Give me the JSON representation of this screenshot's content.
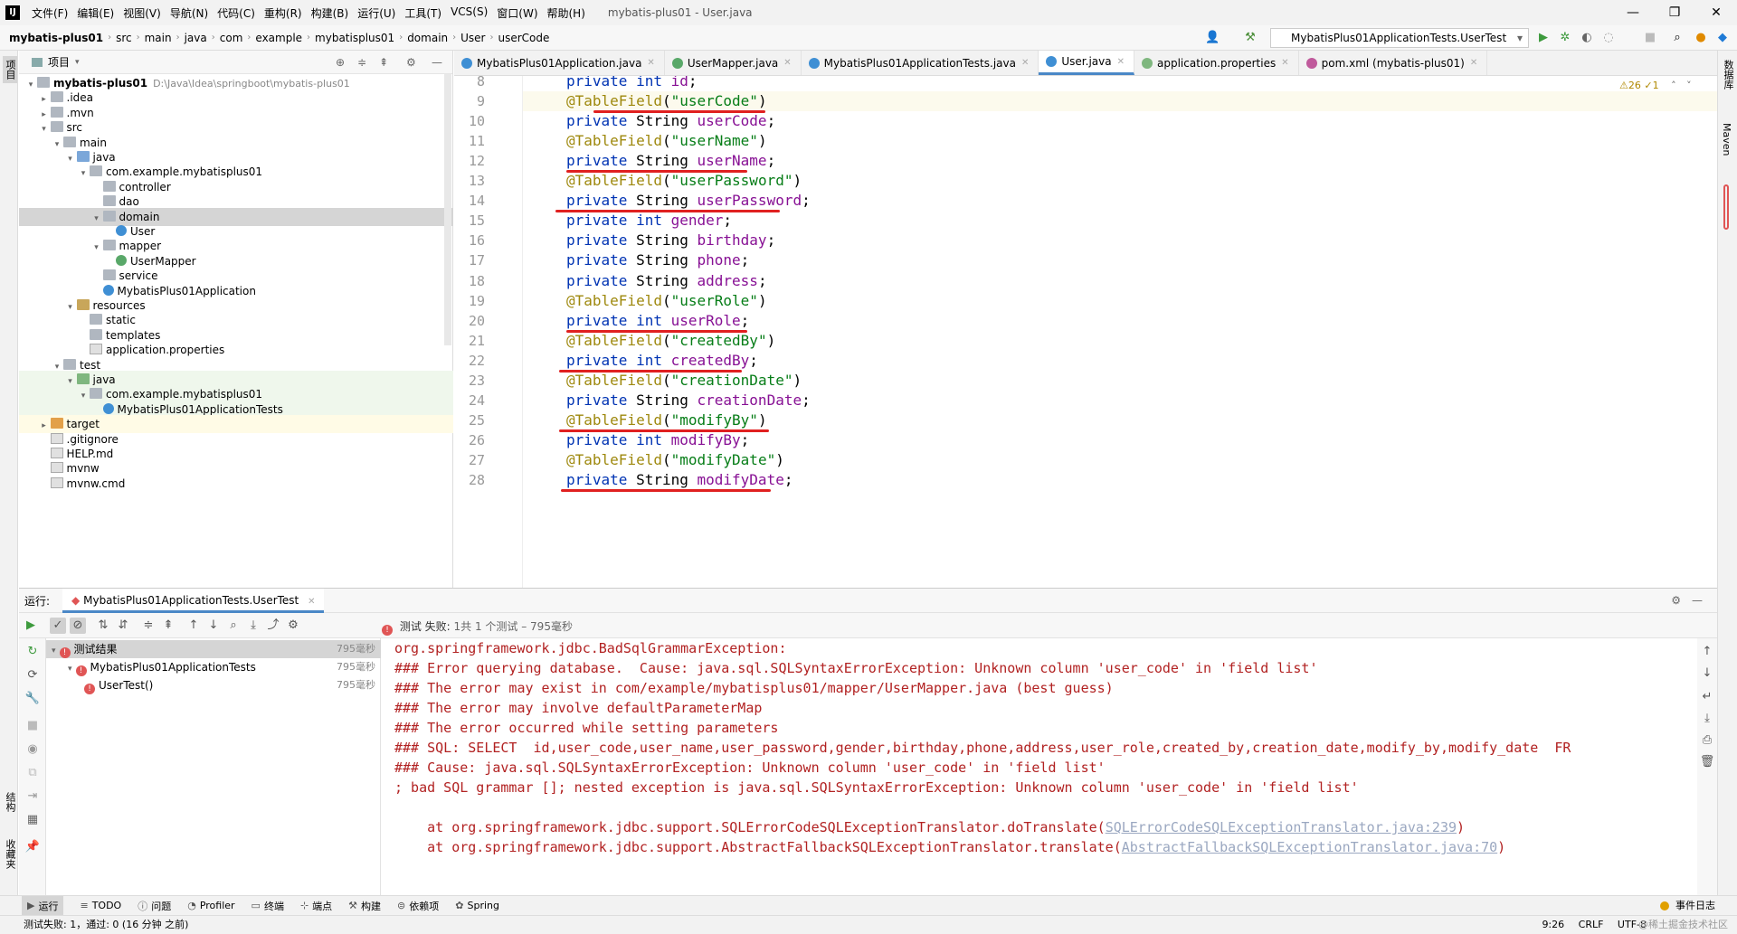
{
  "menubar": {
    "items": [
      "文件(F)",
      "编辑(E)",
      "视图(V)",
      "导航(N)",
      "代码(C)",
      "重构(R)",
      "构建(B)",
      "运行(U)",
      "工具(T)",
      "VCS(S)",
      "窗口(W)",
      "帮助(H)"
    ],
    "window_title": "mybatis-plus01 - User.java"
  },
  "navbar": {
    "crumbs": [
      "mybatis-plus01",
      "src",
      "main",
      "java",
      "com",
      "example",
      "mybatisplus01",
      "domain",
      "User",
      "userCode"
    ],
    "run_config": "MybatisPlus01ApplicationTests.UserTest"
  },
  "left_strip": {
    "project_label": "项目",
    "structure_label": "结构",
    "bookmarks_label": "收藏夹"
  },
  "right_strip": {
    "db_label": "数据库",
    "maven_label": "Maven"
  },
  "project": {
    "header": "项目",
    "tree": [
      {
        "label": "mybatis-plus01",
        "path": "D:\\Java\\Idea\\springboot\\mybatis-plus01",
        "icon": "folder",
        "depth": 0,
        "arrow": "▾"
      },
      {
        "label": ".idea",
        "icon": "folder",
        "depth": 1,
        "arrow": "▸"
      },
      {
        "label": ".mvn",
        "icon": "folder",
        "depth": 1,
        "arrow": "▸"
      },
      {
        "label": "src",
        "icon": "folder",
        "depth": 1,
        "arrow": "▾"
      },
      {
        "label": "main",
        "icon": "folder",
        "depth": 2,
        "arrow": "▾"
      },
      {
        "label": "java",
        "icon": "folder-src",
        "depth": 3,
        "arrow": "▾"
      },
      {
        "label": "com.example.mybatisplus01",
        "icon": "folder",
        "depth": 4,
        "arrow": "▾"
      },
      {
        "label": "controller",
        "icon": "folder",
        "depth": 5,
        "arrow": ""
      },
      {
        "label": "dao",
        "icon": "folder",
        "depth": 5,
        "arrow": ""
      },
      {
        "label": "domain",
        "icon": "folder",
        "depth": 5,
        "arrow": "▾"
      },
      {
        "label": "User",
        "icon": "class",
        "depth": 6,
        "arrow": ""
      },
      {
        "label": "mapper",
        "icon": "folder",
        "depth": 5,
        "arrow": "▾"
      },
      {
        "label": "UserMapper",
        "icon": "interface",
        "depth": 6,
        "arrow": ""
      },
      {
        "label": "service",
        "icon": "folder",
        "depth": 5,
        "arrow": ""
      },
      {
        "label": "MybatisPlus01Application",
        "icon": "class",
        "depth": 5,
        "arrow": ""
      },
      {
        "label": "resources",
        "icon": "folder-res",
        "depth": 3,
        "arrow": "▾"
      },
      {
        "label": "static",
        "icon": "folder",
        "depth": 4,
        "arrow": ""
      },
      {
        "label": "templates",
        "icon": "folder",
        "depth": 4,
        "arrow": ""
      },
      {
        "label": "application.properties",
        "icon": "file",
        "depth": 4,
        "arrow": ""
      },
      {
        "label": "test",
        "icon": "folder",
        "depth": 2,
        "arrow": "▾"
      },
      {
        "label": "java",
        "icon": "folder-test",
        "depth": 3,
        "arrow": "▾"
      },
      {
        "label": "com.example.mybatisplus01",
        "icon": "folder",
        "depth": 4,
        "arrow": "▾"
      },
      {
        "label": "MybatisPlus01ApplicationTests",
        "icon": "class",
        "depth": 5,
        "arrow": ""
      },
      {
        "label": "target",
        "icon": "folder-target",
        "depth": 1,
        "arrow": "▸"
      },
      {
        "label": ".gitignore",
        "icon": "file",
        "depth": 1,
        "arrow": ""
      },
      {
        "label": "HELP.md",
        "icon": "file",
        "depth": 1,
        "arrow": ""
      },
      {
        "label": "mvnw",
        "icon": "file",
        "depth": 1,
        "arrow": ""
      },
      {
        "label": "mvnw.cmd",
        "icon": "file",
        "depth": 1,
        "arrow": ""
      }
    ]
  },
  "editor": {
    "tabs": [
      {
        "label": "MybatisPlus01Application.java",
        "color": "#3f8fd4",
        "active": false
      },
      {
        "label": "UserMapper.java",
        "color": "#59a869",
        "active": false
      },
      {
        "label": "MybatisPlus01ApplicationTests.java",
        "color": "#3f8fd4",
        "active": false
      },
      {
        "label": "User.java",
        "color": "#3f8fd4",
        "active": true
      },
      {
        "label": "application.properties",
        "color": "#7fb77f",
        "active": false
      },
      {
        "label": "pom.xml (mybatis-plus01)",
        "color": "#c05a9c",
        "active": false
      }
    ],
    "warnings": "⚠26  ✓1",
    "lines": [
      {
        "n": "8",
        "parts": [
          [
            "kw",
            "private "
          ],
          [
            "kw",
            "int "
          ],
          [
            "fld",
            "id"
          ],
          [
            "",
            "; "
          ]
        ]
      },
      {
        "n": "9",
        "parts": [
          [
            "ann",
            "@TableField"
          ],
          [
            "",
            "("
          ],
          [
            "str",
            "\"userCode\""
          ],
          [
            "",
            ")"
          ]
        ],
        "current": true
      },
      {
        "n": "10",
        "parts": [
          [
            "kw",
            "private "
          ],
          [
            "",
            "String "
          ],
          [
            "fld",
            "userCode"
          ],
          [
            "",
            ";"
          ]
        ]
      },
      {
        "n": "11",
        "parts": [
          [
            "ann",
            "@TableField"
          ],
          [
            "",
            "("
          ],
          [
            "str",
            "\"userName\""
          ],
          [
            "",
            ")"
          ]
        ]
      },
      {
        "n": "12",
        "parts": [
          [
            "kw",
            "private "
          ],
          [
            "",
            "String "
          ],
          [
            "fld",
            "userName"
          ],
          [
            "",
            ";"
          ]
        ]
      },
      {
        "n": "13",
        "parts": [
          [
            "ann",
            "@TableField"
          ],
          [
            "",
            "("
          ],
          [
            "str",
            "\"userPassword\""
          ],
          [
            "",
            ")"
          ]
        ]
      },
      {
        "n": "14",
        "parts": [
          [
            "kw",
            "private "
          ],
          [
            "",
            "String "
          ],
          [
            "fld",
            "userPassword"
          ],
          [
            "",
            ";"
          ]
        ]
      },
      {
        "n": "15",
        "parts": [
          [
            "kw",
            "private "
          ],
          [
            "kw",
            "int "
          ],
          [
            "fld",
            "gender"
          ],
          [
            "",
            ";"
          ]
        ]
      },
      {
        "n": "16",
        "parts": [
          [
            "kw",
            "private "
          ],
          [
            "",
            "String "
          ],
          [
            "fld",
            "birthday"
          ],
          [
            "",
            ";"
          ]
        ]
      },
      {
        "n": "17",
        "parts": [
          [
            "kw",
            "private "
          ],
          [
            "",
            "String "
          ],
          [
            "fld",
            "phone"
          ],
          [
            "",
            ";"
          ]
        ]
      },
      {
        "n": "18",
        "parts": [
          [
            "kw",
            "private "
          ],
          [
            "",
            "String "
          ],
          [
            "fld",
            "address"
          ],
          [
            "",
            ";"
          ]
        ]
      },
      {
        "n": "19",
        "parts": [
          [
            "ann",
            "@TableField"
          ],
          [
            "",
            "("
          ],
          [
            "str",
            "\"userRole\""
          ],
          [
            "",
            ")"
          ]
        ]
      },
      {
        "n": "20",
        "parts": [
          [
            "kw",
            "private "
          ],
          [
            "kw",
            "int "
          ],
          [
            "fld",
            "userRole"
          ],
          [
            "",
            ";"
          ]
        ]
      },
      {
        "n": "21",
        "parts": [
          [
            "ann",
            "@TableField"
          ],
          [
            "",
            "("
          ],
          [
            "str",
            "\"createdBy\""
          ],
          [
            "",
            ")"
          ]
        ]
      },
      {
        "n": "22",
        "parts": [
          [
            "kw",
            "private "
          ],
          [
            "kw",
            "int "
          ],
          [
            "fld",
            "createdBy"
          ],
          [
            "",
            ";"
          ]
        ]
      },
      {
        "n": "23",
        "parts": [
          [
            "ann",
            "@TableField"
          ],
          [
            "",
            "("
          ],
          [
            "str",
            "\"creationDate\""
          ],
          [
            "",
            ")"
          ]
        ]
      },
      {
        "n": "24",
        "parts": [
          [
            "kw",
            "private "
          ],
          [
            "",
            "String "
          ],
          [
            "fld",
            "creationDate"
          ],
          [
            "",
            ";"
          ]
        ]
      },
      {
        "n": "25",
        "parts": [
          [
            "ann",
            "@TableField"
          ],
          [
            "",
            "("
          ],
          [
            "str",
            "\"modifyBy\""
          ],
          [
            "",
            ")"
          ]
        ]
      },
      {
        "n": "26",
        "parts": [
          [
            "kw",
            "private "
          ],
          [
            "kw",
            "int "
          ],
          [
            "fld",
            "modifyBy"
          ],
          [
            "",
            ";"
          ]
        ]
      },
      {
        "n": "27",
        "parts": [
          [
            "ann",
            "@TableField"
          ],
          [
            "",
            "("
          ],
          [
            "str",
            "\"modifyDate\""
          ],
          [
            "",
            ")"
          ]
        ]
      },
      {
        "n": "28",
        "parts": [
          [
            "kw",
            "private "
          ],
          [
            "",
            "String "
          ],
          [
            "fld",
            "modifyDate"
          ],
          [
            "",
            ";"
          ]
        ]
      }
    ]
  },
  "run": {
    "label": "运行:",
    "tab": "MybatisPlus01ApplicationTests.UserTest",
    "status_prefix": "测试 失败:",
    "status_detail": "1共 1 个测试 – 795毫秒",
    "tree": [
      {
        "label": "测试结果",
        "time": "795毫秒",
        "depth": 0
      },
      {
        "label": "MybatisPlus01ApplicationTests",
        "time": "795毫秒",
        "depth": 1
      },
      {
        "label": "UserTest()",
        "time": "795毫秒",
        "depth": 2
      }
    ],
    "console": [
      {
        "text": "org.springframework.jdbc.BadSqlGrammarException:"
      },
      {
        "text": "### Error querying database.  Cause: java.sql.SQLSyntaxErrorException: Unknown column 'user_code' in 'field list'"
      },
      {
        "text": "### The error may exist in com/example/mybatisplus01/mapper/UserMapper.java (best guess)"
      },
      {
        "text": "### The error may involve defaultParameterMap"
      },
      {
        "text": "### The error occurred while setting parameters"
      },
      {
        "text": "### SQL: SELECT  id,user_code,user_name,user_password,gender,birthday,phone,address,user_role,created_by,creation_date,modify_by,modify_date  FR"
      },
      {
        "text": "### Cause: java.sql.SQLSyntaxErrorException: Unknown column 'user_code' in 'field list'"
      },
      {
        "text": "; bad SQL grammar []; nested exception is java.sql.SQLSyntaxErrorException: Unknown column 'user_code' in 'field list'"
      },
      {
        "text": ""
      },
      {
        "text": "    at org.springframework.jdbc.support.SQLErrorCodeSQLExceptionTranslator.doTranslate(",
        "link": "SQLErrorCodeSQLExceptionTranslator.java:239",
        "tail": ")"
      },
      {
        "text": "    at org.springframework.jdbc.support.AbstractFallbackSQLExceptionTranslator.translate(",
        "link": "AbstractFallbackSQLExceptionTranslator.java:70",
        "tail": ")"
      }
    ]
  },
  "bottombar": {
    "items": [
      "运行",
      "TODO",
      "问题",
      "Profiler",
      "终端",
      "端点",
      "构建",
      "依赖项",
      "Spring"
    ],
    "event_log": "事件日志"
  },
  "statusbar": {
    "message": "测试失败: 1，通过: 0 (16 分钟 之前)",
    "position": "9:26",
    "line_sep": "CRLF",
    "encoding": "UTF-8",
    "watermark": "@稀土掘金技术社区"
  },
  "colors": {
    "keyword": "#0033b3",
    "annotation": "#9e880d",
    "string": "#067d17",
    "field": "#871094",
    "error": "#b22222",
    "underline": "#e02020"
  }
}
